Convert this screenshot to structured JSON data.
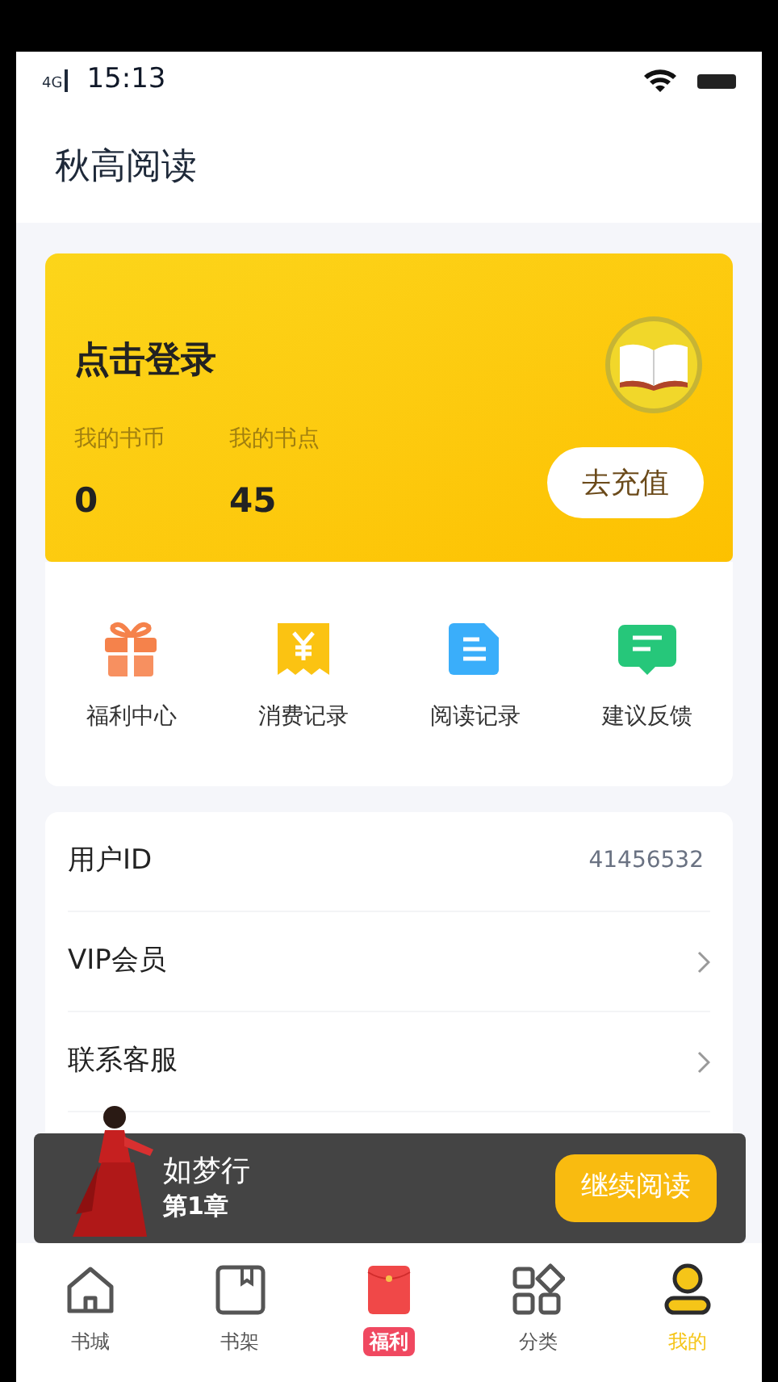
{
  "status_bar": {
    "time": "15:13",
    "network": "4G"
  },
  "header": {
    "title": "秋高阅读"
  },
  "account_card": {
    "login": "点击登录",
    "stats": [
      {
        "label": "我的书币",
        "value": "0"
      },
      {
        "label": "我的书点",
        "value": "45"
      }
    ],
    "recharge_button": "去充值"
  },
  "shortcuts": [
    {
      "kind": "gift",
      "label": "福利中心"
    },
    {
      "kind": "receipt",
      "label": "消费记录"
    },
    {
      "kind": "document",
      "label": "阅读记录"
    },
    {
      "kind": "chat",
      "label": "建议反馈"
    }
  ],
  "menu": [
    {
      "label": "用户ID",
      "value": "41456532",
      "arrow": false
    },
    {
      "label": "VIP会员",
      "arrow": true
    },
    {
      "label": "联系客服",
      "arrow": true
    }
  ],
  "player": {
    "title": "如梦行",
    "chapter": "第1章",
    "button": "继续阅读"
  },
  "tabs": [
    {
      "kind": "home",
      "label": "书城",
      "selected": false
    },
    {
      "kind": "shelf",
      "label": "书架",
      "selected": false
    },
    {
      "kind": "redpacket",
      "label": "福利",
      "selected": false
    },
    {
      "kind": "category",
      "label": "分类",
      "selected": false
    },
    {
      "kind": "user",
      "label": "我的",
      "selected": true
    }
  ]
}
